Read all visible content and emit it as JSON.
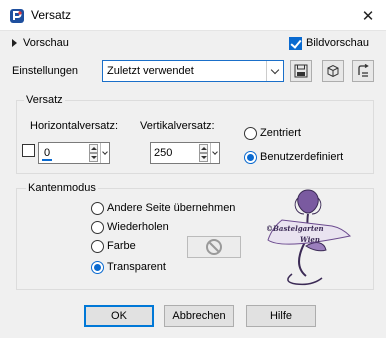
{
  "window": {
    "title": "Versatz"
  },
  "preview": {
    "label": "Vorschau"
  },
  "bildvorschau": {
    "label": "Bildvorschau",
    "checked": true
  },
  "einstellungen": {
    "label": "Einstellungen",
    "value": "Zuletzt verwendet"
  },
  "toolbar": {
    "icons": [
      "save-icon",
      "reset-icon",
      "restore-icon"
    ]
  },
  "versatz": {
    "title": "Versatz",
    "horizontal": {
      "label": "Horizontalversatz:",
      "value": "0"
    },
    "vertical": {
      "label": "Vertikalversatz:",
      "value": "250"
    },
    "radios": [
      {
        "label": "Zentriert",
        "selected": false
      },
      {
        "label": "Benutzerdefiniert",
        "selected": true
      }
    ]
  },
  "kantenmodus": {
    "title": "Kantenmodus",
    "radios": [
      {
        "label": "Andere Seite übernehmen",
        "selected": false
      },
      {
        "label": "Wiederholen",
        "selected": false
      },
      {
        "label": "Farbe",
        "selected": false
      },
      {
        "label": "Transparent",
        "selected": true
      }
    ]
  },
  "watermark": {
    "line1": "©Bastelgarten",
    "line2": "Wien"
  },
  "buttons": {
    "ok": "OK",
    "cancel": "Abbrechen",
    "help": "Hilfe"
  },
  "colors": {
    "accent": "#0a6ad0",
    "watermark": "#6b4a8e"
  }
}
